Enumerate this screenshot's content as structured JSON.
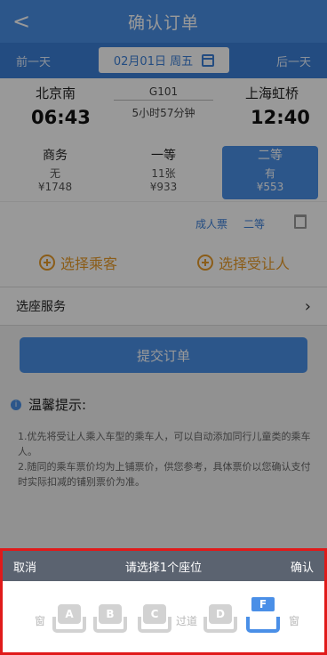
{
  "header": {
    "title": "确认订单",
    "back_label": "<"
  },
  "date_bar": {
    "prev": "前一天",
    "date": "02月01日 周五",
    "next": "后一天"
  },
  "train": {
    "from_station": "北京南",
    "to_station": "上海虹桥",
    "depart_time": "06:43",
    "arrive_time": "12:40",
    "train_no": "G101",
    "duration": "5小时57分钟"
  },
  "seat_classes": [
    {
      "name": "商务",
      "availability": "无",
      "price": "¥1748"
    },
    {
      "name": "一等",
      "availability": "11张",
      "price": "¥933"
    },
    {
      "name": "二等",
      "availability": "有",
      "price": "¥553"
    }
  ],
  "passenger": {
    "ticket_type": "成人票",
    "seat_type": "二等"
  },
  "actions": {
    "select_passenger": "选择乘客",
    "select_recipient": "选择受让人"
  },
  "service": {
    "label": "选座服务"
  },
  "submit_label": "提交订单",
  "tips": {
    "title": "温馨提示:",
    "line1": "1.优先将受让人乘入车型的乘车人，可以自动添加同行儿童类的乘车人。",
    "line2": "2.随同的乘车票价均为上铺票价，供您参考，具体票价以您确认支付时实际扣减的铺别票价为准。"
  },
  "seat_sheet": {
    "cancel": "取消",
    "title": "请选择1个座位",
    "confirm": "确认",
    "left_edge": "窗",
    "aisle": "过道",
    "right_edge": "窗",
    "seats": [
      "A",
      "B",
      "C",
      "D",
      "F"
    ],
    "selected_seat": "F",
    "colors": {
      "selected": "#4a8fe7",
      "unselected": "#d2d2d2",
      "highlight_border": "#e01a1a"
    }
  }
}
